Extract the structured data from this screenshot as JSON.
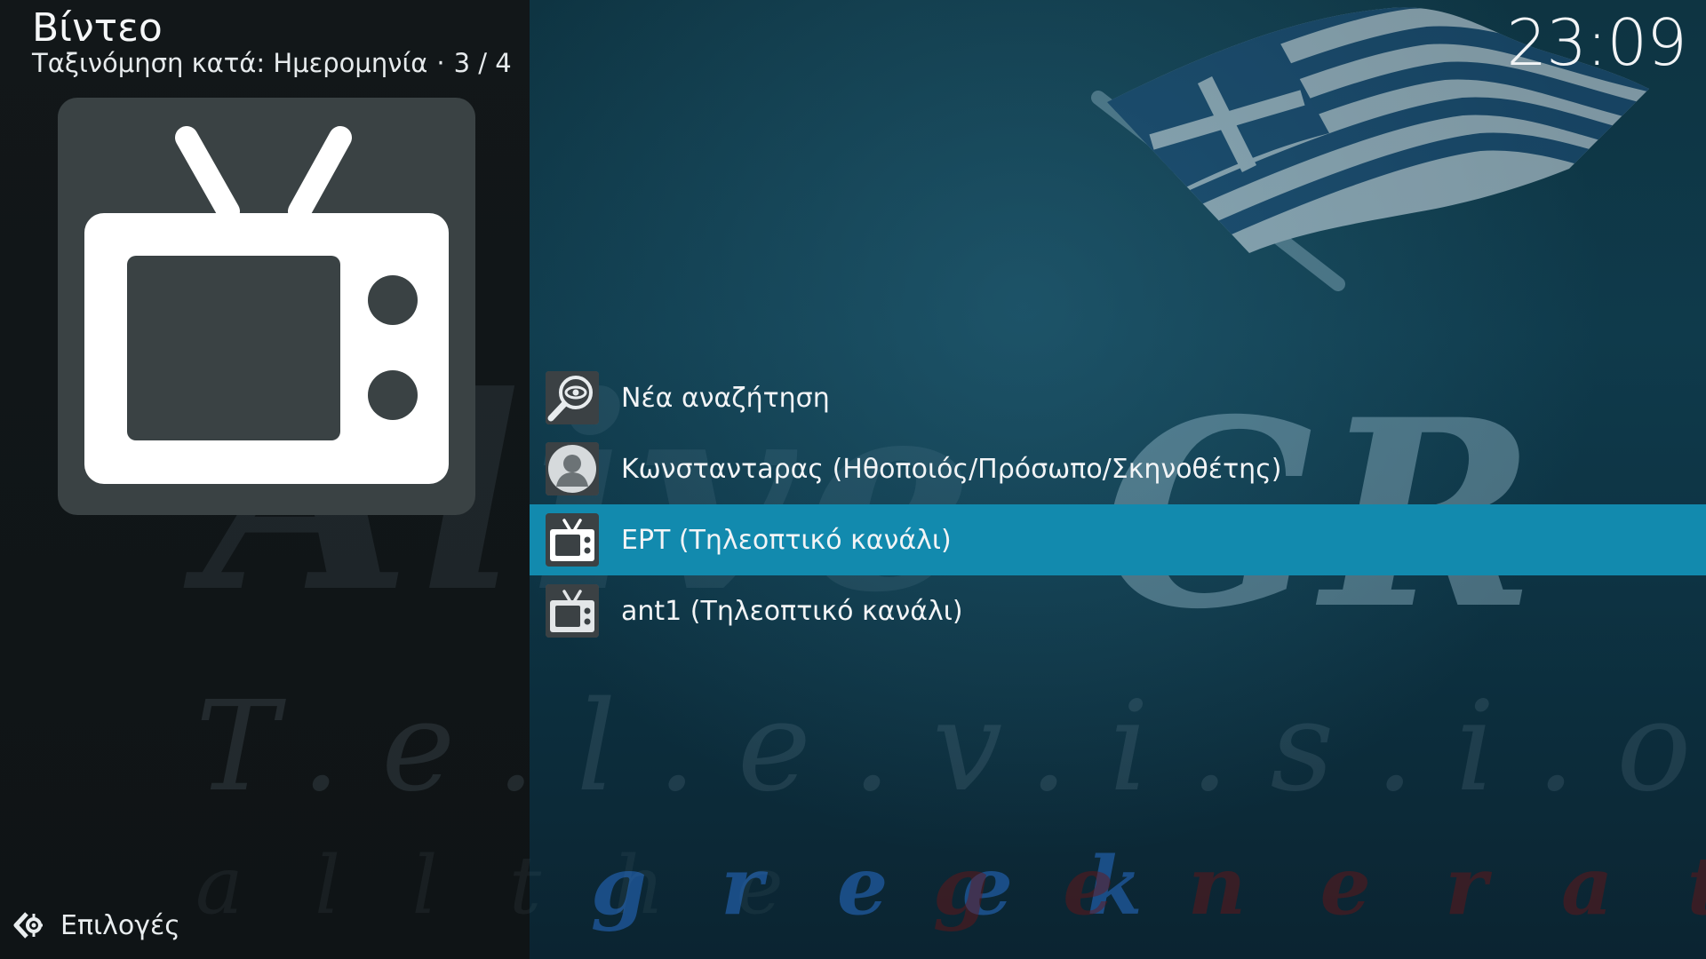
{
  "header": {
    "title": "Βίντεο",
    "sort_label": "Ταξινόμηση κατά: Ημερομηνία",
    "separator": "·",
    "position": "3 / 4"
  },
  "clock": "23:09",
  "thumbnail": {
    "icon": "tv-icon"
  },
  "list": {
    "items": [
      {
        "label": "Νέα αναζήτηση",
        "icon": "search-eye-icon",
        "selected": false
      },
      {
        "label": "Κωνσταντaρας (Ηθοποιός/Πρόσωπο/Σκηνοθέτης)",
        "icon": "person-icon",
        "selected": false
      },
      {
        "label": "EPT (Τηλεοπτικό κανάλι)",
        "icon": "tv-icon",
        "selected": true
      },
      {
        "label": "ant1 (Τηλεοπτικό κανάλι)",
        "icon": "tv-icon",
        "selected": false
      }
    ]
  },
  "options": {
    "label": "Επιλογές",
    "icon": "options-arrow-icon"
  },
  "fanart": {
    "logo_main": "AliveGR",
    "logo_sub": "Television",
    "logo_tag": "all the greek generation"
  },
  "colors": {
    "selected_row": "#128aae",
    "left_panel": "#121719",
    "thumb_bg": "#3a4244"
  }
}
